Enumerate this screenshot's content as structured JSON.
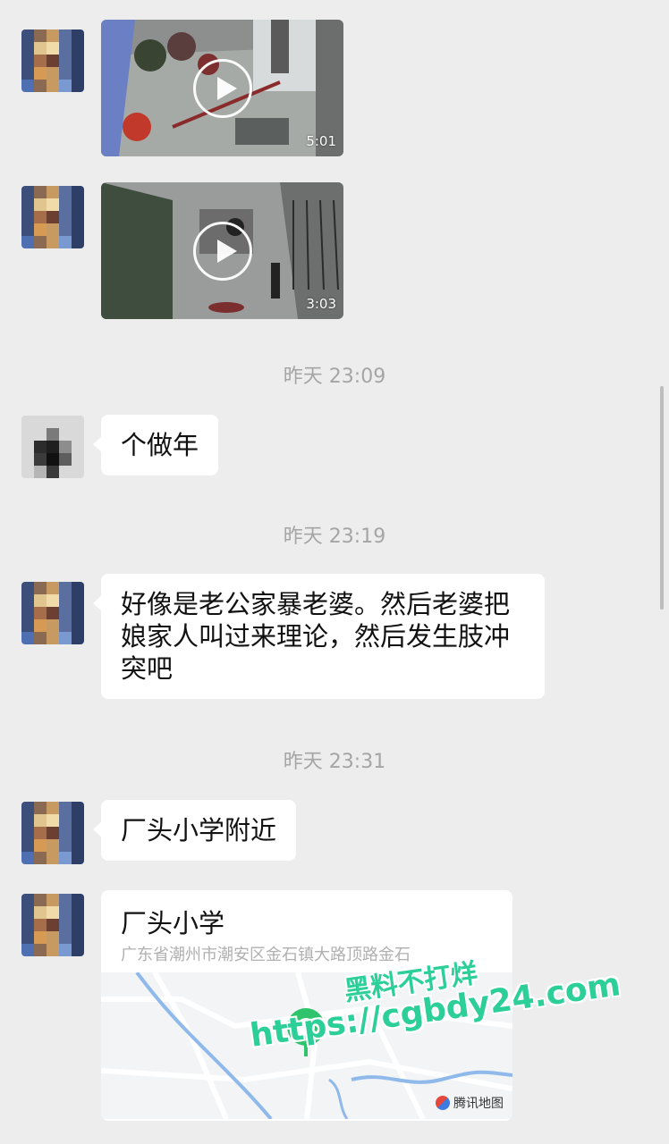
{
  "messages": {
    "video1": {
      "duration": "5:01"
    },
    "video2": {
      "duration": "3:03"
    },
    "time1": "昨天 23:09",
    "msg1": "个做年",
    "time2": "昨天 23:19",
    "msg2": "好像是老公家暴老婆。然后老婆把娘家人叫过来理论，然后发生肢冲突吧",
    "time3": "昨天 23:31",
    "msg3": "厂头小学附近",
    "location": {
      "title": "厂头小学",
      "address": "广东省潮州市潮安区金石镇大路顶路金石",
      "map_credit": "腾讯地图"
    }
  },
  "watermark": {
    "line1": "黑料不打烊",
    "line2": "https://cgbdy24.com"
  },
  "colors": {
    "background": "#ededed",
    "bubble": "#ffffff",
    "timestamp": "#a5a5a5",
    "pin": "#2fc36b",
    "watermark": "#2ccf98"
  }
}
